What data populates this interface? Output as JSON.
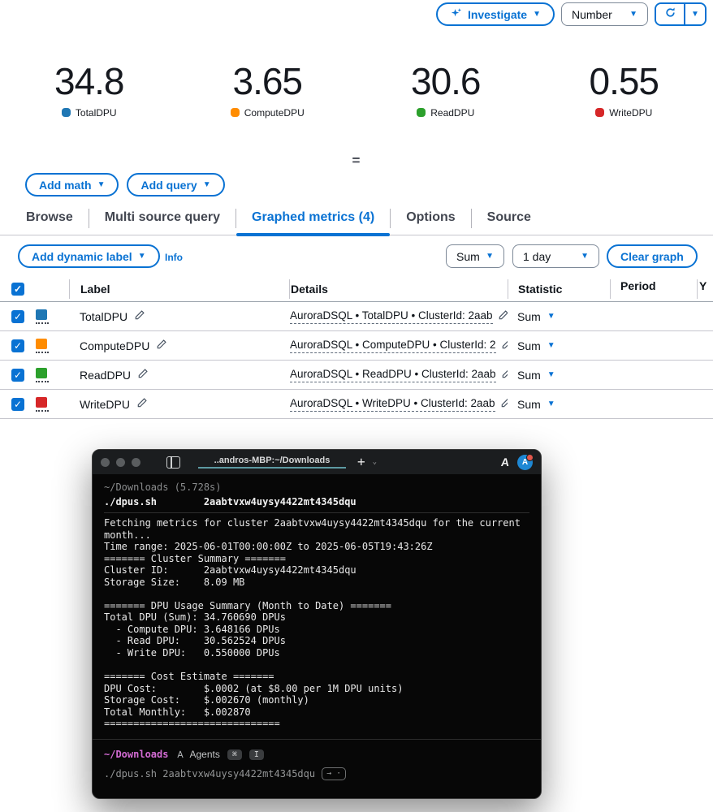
{
  "accent_color": "#0972d3",
  "topbar": {
    "investigate_label": "Investigate",
    "number_label": "Number"
  },
  "metrics": [
    {
      "value": "34.8",
      "label": "TotalDPU",
      "color": "#1f77b4"
    },
    {
      "value": "3.65",
      "label": "ComputeDPU",
      "color": "#ff8c00"
    },
    {
      "value": "30.6",
      "label": "ReadDPU",
      "color": "#2ca02c"
    },
    {
      "value": "0.55",
      "label": "WriteDPU",
      "color": "#d62728"
    }
  ],
  "actions": {
    "add_math": "Add math",
    "add_query": "Add query"
  },
  "tabs": [
    {
      "label": "Browse"
    },
    {
      "label": "Multi source query"
    },
    {
      "label": "Graphed metrics (4)"
    },
    {
      "label": "Options"
    },
    {
      "label": "Source"
    }
  ],
  "graph_controls": {
    "add_dynamic_label": "Add dynamic label",
    "info": "Info",
    "statistic": "Sum",
    "period": "1 day",
    "clear_graph": "Clear graph"
  },
  "table": {
    "columns": {
      "label": "Label",
      "details": "Details",
      "statistic": "Statistic",
      "period": "Period",
      "y": "Y"
    },
    "rows": [
      {
        "label": "TotalDPU",
        "color": "#1f77b4",
        "details": "AuroraDSQL • TotalDPU • ClusterId: 2aab",
        "statistic": "Sum"
      },
      {
        "label": "ComputeDPU",
        "color": "#ff8c00",
        "details": "AuroraDSQL • ComputeDPU • ClusterId: 2",
        "statistic": "Sum"
      },
      {
        "label": "ReadDPU",
        "color": "#2ca02c",
        "details": "AuroraDSQL • ReadDPU • ClusterId: 2aab",
        "statistic": "Sum"
      },
      {
        "label": "WriteDPU",
        "color": "#d62728",
        "details": "AuroraDSQL • WriteDPU • ClusterId: 2aab",
        "statistic": "Sum"
      }
    ]
  },
  "terminal": {
    "tab_title": "..andros-MBP:~/Downloads",
    "block_header": "~/Downloads (5.728s)",
    "command_line": "./dpus.sh        2aabtvxw4uysy4422mt4345dqu",
    "output_text": "Fetching metrics for cluster 2aabtvxw4uysy4422mt4345dqu for the current\nmonth...\nTime range: 2025-06-01T00:00:00Z to 2025-06-05T19:43:26Z\n======= Cluster Summary =======\nCluster ID:      2aabtvxw4uysy4422mt4345dqu\nStorage Size:    8.09 MB\n\n======= DPU Usage Summary (Month to Date) =======\nTotal DPU (Sum): 34.760690 DPUs\n  - Compute DPU: 3.648166 DPUs\n  - Read DPU:    30.562524 DPUs\n  - Write DPU:   0.550000 DPUs\n\n======= Cost Estimate =======\nDPU Cost:        $.0002 (at $8.00 per 1M DPU units)\nStorage Cost:    $.002670 (monthly)\nTotal Monthly:   $.002870\n==============================",
    "prompt_path": "~/Downloads",
    "prompt_mode": "Agents",
    "kbd_1": "⌘",
    "kbd_2": "I",
    "suggestion": "./dpus.sh 2aabtvxw4uysy4422mt4345dqu",
    "suggestion_hint": "→ ·",
    "avatar_letter": "A",
    "ai_letter": "A"
  }
}
